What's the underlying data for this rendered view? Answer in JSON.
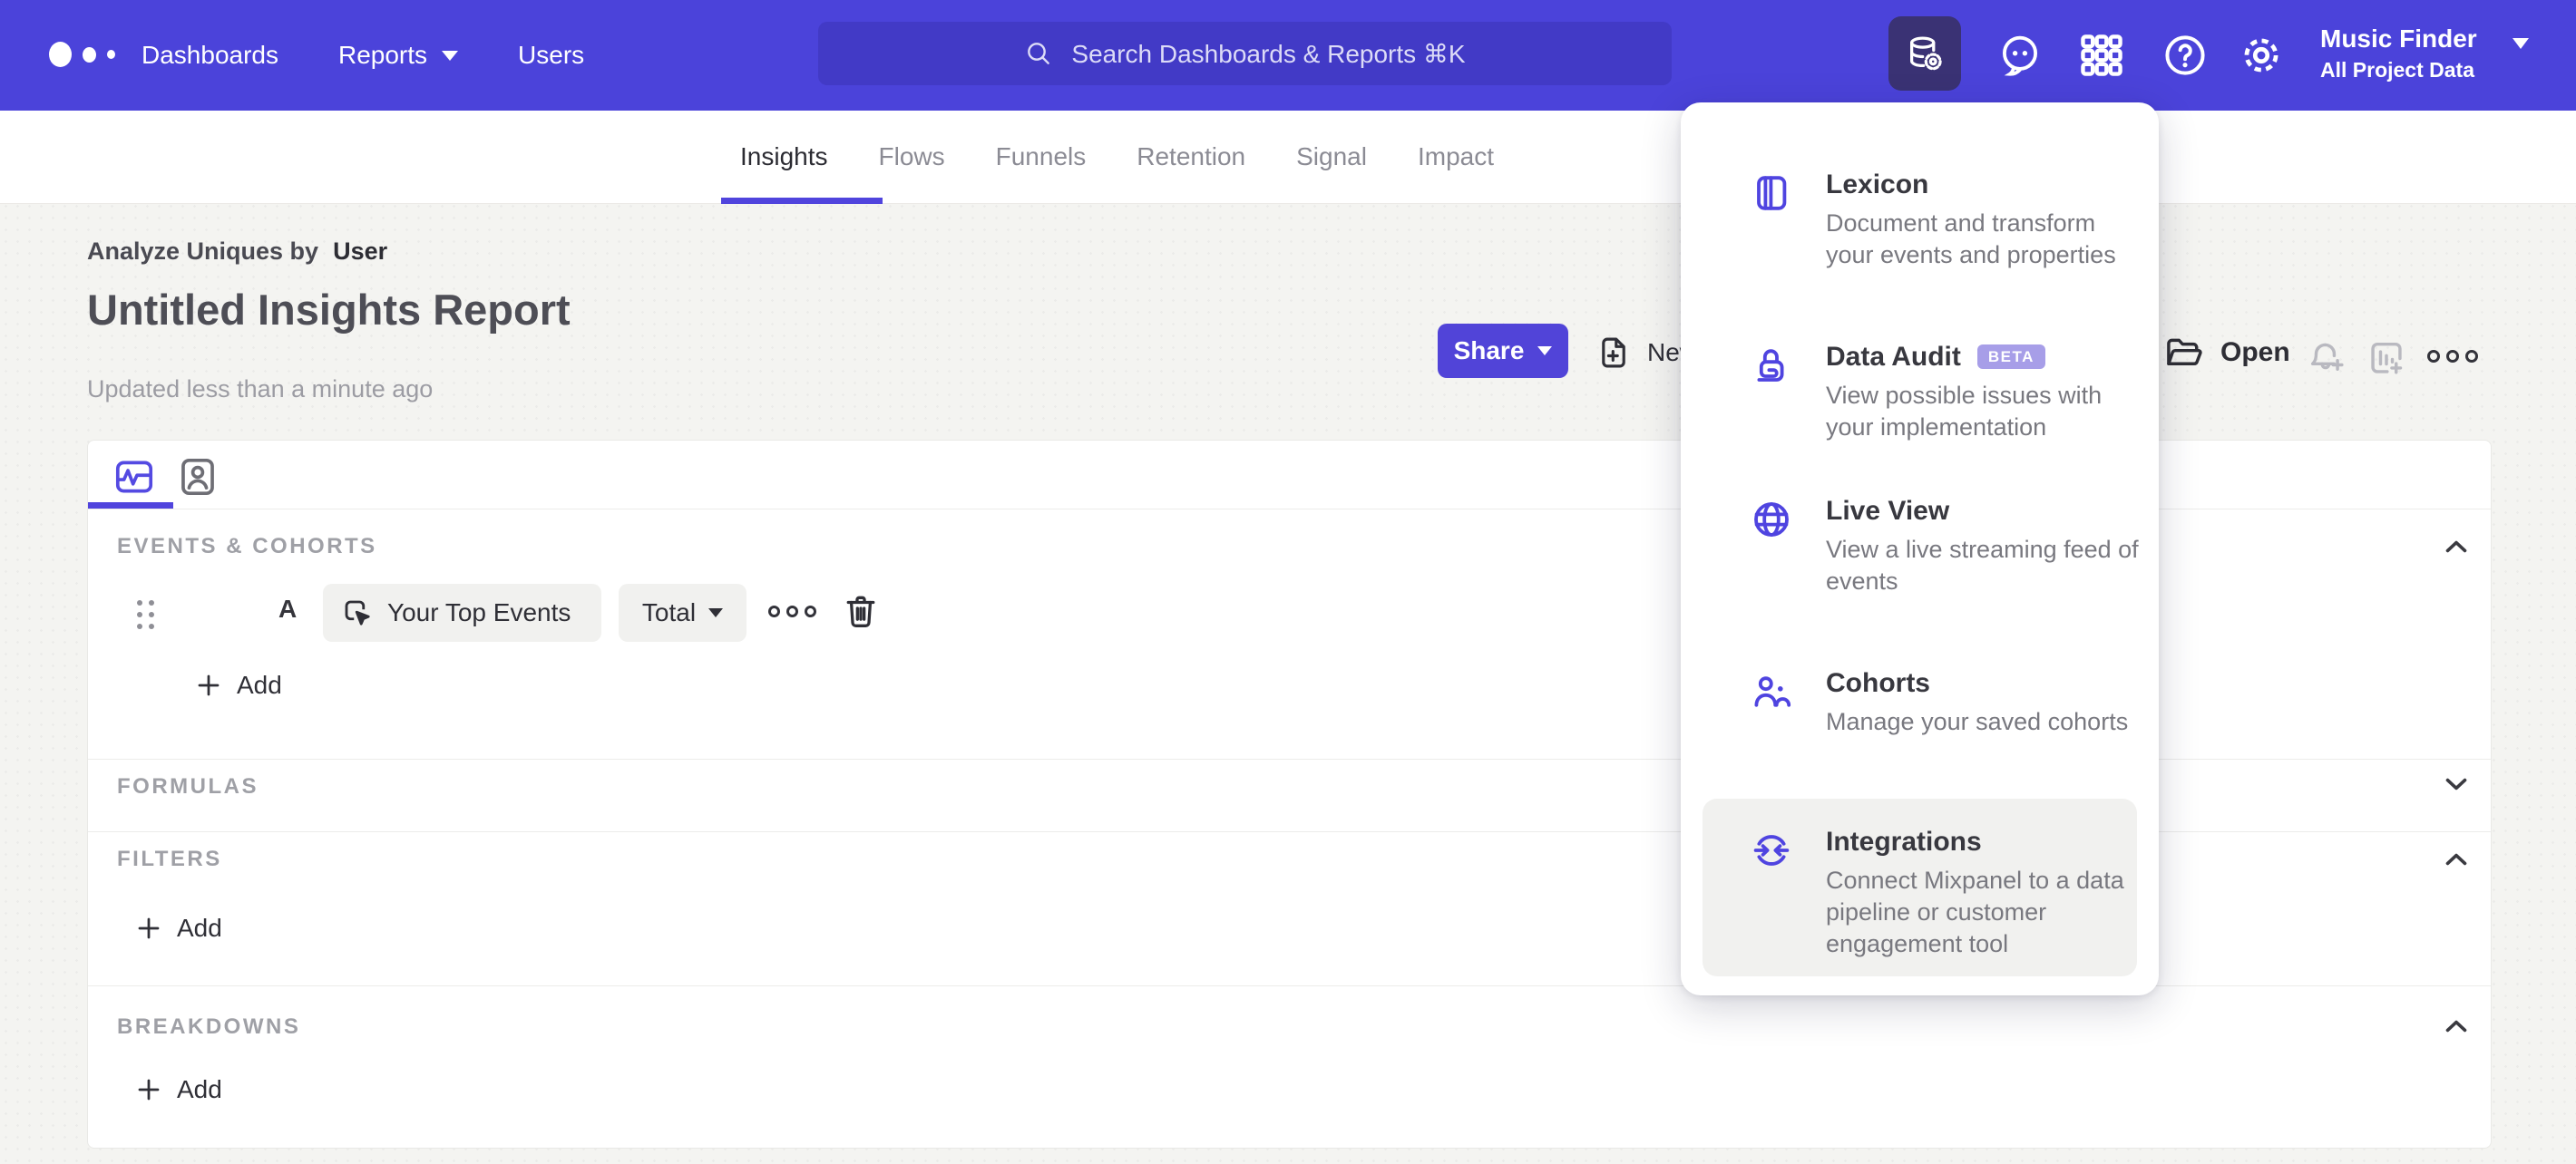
{
  "topbar": {
    "nav": [
      {
        "label": "Dashboards"
      },
      {
        "label": "Reports"
      },
      {
        "label": "Users"
      }
    ],
    "search_placeholder": "Search Dashboards & Reports ⌘K",
    "project": {
      "name": "Music Finder",
      "scope": "All Project Data"
    }
  },
  "tabs": [
    {
      "label": "Insights"
    },
    {
      "label": "Flows"
    },
    {
      "label": "Funnels"
    },
    {
      "label": "Retention"
    },
    {
      "label": "Signal"
    },
    {
      "label": "Impact"
    }
  ],
  "report": {
    "breadcrumb_prefix": "Analyze Uniques by",
    "breadcrumb_value": "User",
    "title": "Untitled Insights Report",
    "updated": "Updated less than a minute ago",
    "share_label": "Share",
    "new_report_label": "New Report",
    "open_label": "Open"
  },
  "builder": {
    "events_label": "EVENTS & COHORTS",
    "formulas_label": "FORMULAS",
    "filters_label": "FILTERS",
    "breakdowns_label": "BREAKDOWNS",
    "event_row": {
      "letter": "A",
      "event": "Your Top Events",
      "aggregation": "Total"
    },
    "add_label": "Add"
  },
  "menu": {
    "items": [
      {
        "title": "Lexicon",
        "desc": "Document and transform your events and properties"
      },
      {
        "title": "Data Audit",
        "badge": "BETA",
        "desc": "View possible issues with your implementation"
      },
      {
        "title": "Live View",
        "desc": "View a live streaming feed of events"
      },
      {
        "title": "Cohorts",
        "desc": "Manage your saved cohorts"
      },
      {
        "title": "Integrations",
        "desc": "Connect Mixpanel to a data pipeline or customer engagement tool"
      }
    ]
  },
  "colors": {
    "topbar": "#4b43da",
    "search_bg": "#423ac6",
    "accent": "#5044dd",
    "menu_icon": "#4f44e0",
    "beta_bg": "#a79ee8",
    "page_bg": "#f4f4f1"
  }
}
